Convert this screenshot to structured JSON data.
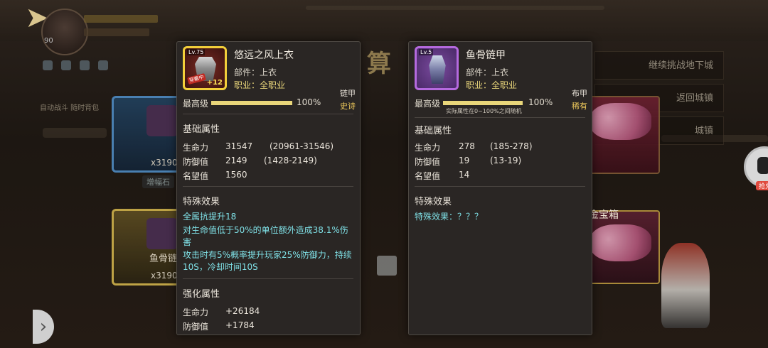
{
  "background": {
    "player_level": "90",
    "auto_battle_text": "自动战斗 随时背包",
    "big_title": "结 算",
    "chest_blue": {
      "count": "x3190"
    },
    "chest_gold": {
      "name": "鱼骨链",
      "count": "x3190"
    },
    "bg_tag": "增幅石",
    "gold_box_label": "金宝箱",
    "side_buttons": [
      "继续挑战地下城",
      "返回城镇",
      "城镇"
    ],
    "tiktok_tag": "抢兑"
  },
  "left_item": {
    "level_badge": "Lv.75",
    "enhance": "+12",
    "badge": "穿戴中",
    "name": "悠远之风上衣",
    "slot": "部件：上衣",
    "class": "职业：全职业",
    "type": "链甲",
    "rarity": "史诗",
    "max_label": "最高级",
    "max_pct": "100%",
    "max_fraction": 1.0,
    "base_title": "基础属性",
    "base_stats": [
      {
        "name": "生命力",
        "value": "31547",
        "range": "(20961-31546)"
      },
      {
        "name": "防御值",
        "value": "2149",
        "range": "(1428-2149)"
      },
      {
        "name": "名望值",
        "value": "1560",
        "range": ""
      }
    ],
    "effect_title": "特殊效果",
    "effects": [
      "全属抗提升18",
      "对生命值低于50%的单位额外造成38.1%伤害",
      "攻击时有5%概率提升玩家25%防御力，持续10S，冷却时间10S"
    ],
    "enhance_title": "强化属性",
    "enhance_stats": [
      {
        "name": "生命力",
        "value": "+26184"
      },
      {
        "name": "防御值",
        "value": "+1784"
      }
    ]
  },
  "right_item": {
    "level_badge": "Lv.5",
    "name": "鱼骨链甲",
    "slot": "部件：上衣",
    "class": "职业：全职业",
    "type": "布甲",
    "rarity": "稀有",
    "max_label": "最高级",
    "max_pct": "100%",
    "max_fraction": 1.0,
    "hint": "实际属性在0~100%之间随机",
    "base_title": "基础属性",
    "base_stats": [
      {
        "name": "生命力",
        "value": "278",
        "range": "(185-278)"
      },
      {
        "name": "防御值",
        "value": "19",
        "range": "(13-19)"
      },
      {
        "name": "名望值",
        "value": "14",
        "range": ""
      }
    ],
    "effect_title": "特殊效果",
    "effects": [
      "特殊效果：？？？"
    ]
  }
}
